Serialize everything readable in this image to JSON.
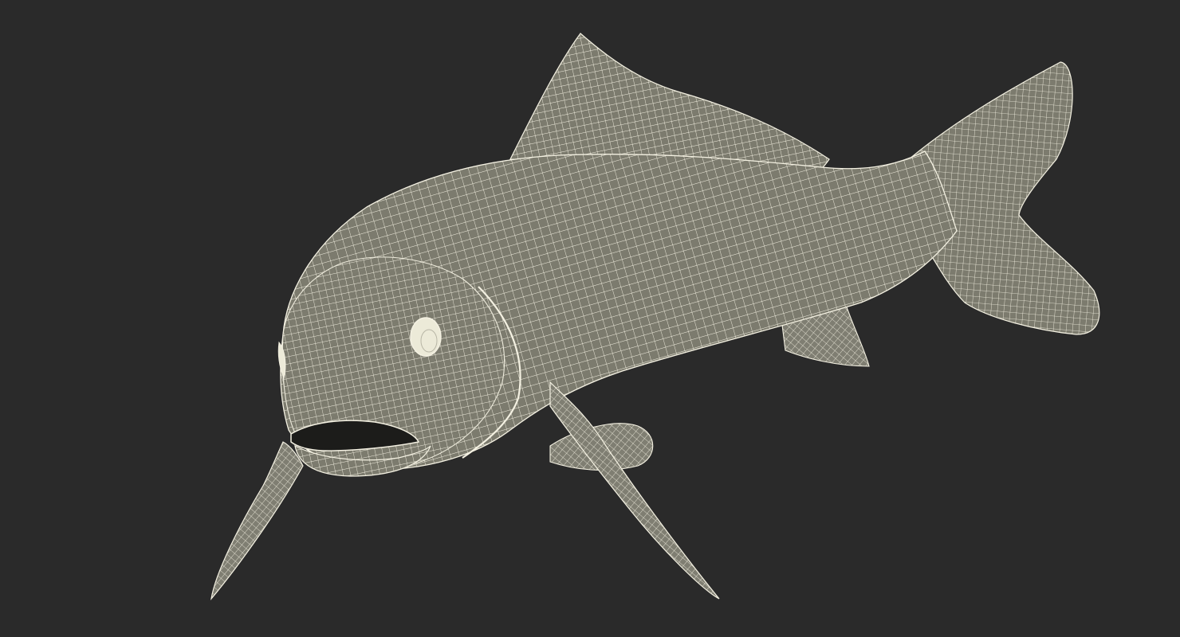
{
  "scene": {
    "subject": "fish-wireframe-model",
    "background_color": "#2a2a2a",
    "mesh_fill_color": "#7c7b6e",
    "mesh_line_color": "#f4f1e2",
    "mouth_color": "#1c1c1a",
    "eye_color": "#ecead8"
  }
}
